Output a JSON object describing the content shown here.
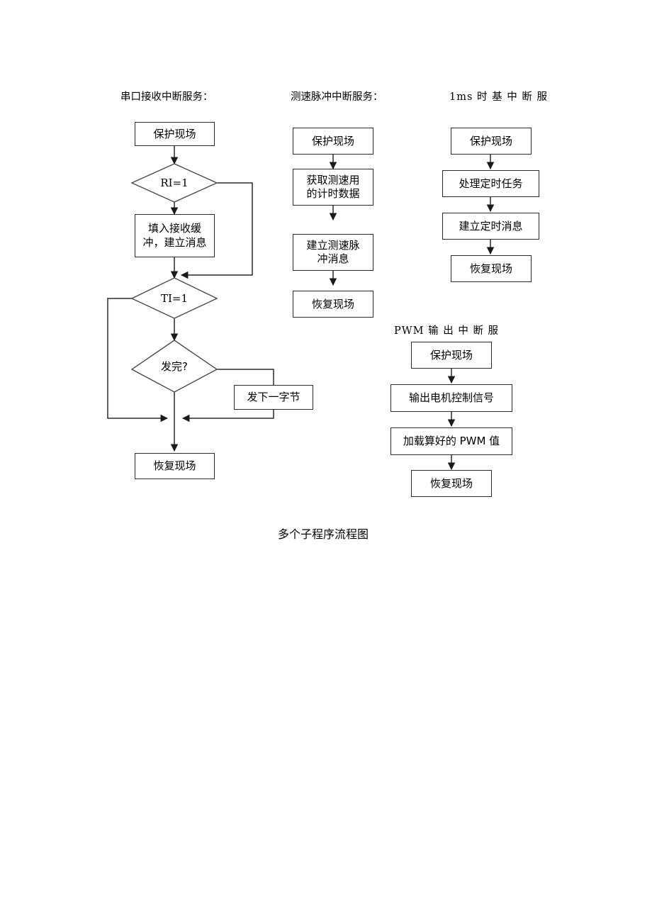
{
  "page": {
    "caption": "多个子程序流程图",
    "background": "#ffffff",
    "line_color": "#2b2b2b",
    "text_color": "#000000"
  },
  "columns": {
    "serial_rx": {
      "header": "串口接收中断服务：",
      "nodes": {
        "save_context": "保护现场",
        "ri_check": "RI=1",
        "fill_buffer": "填入接收缓\n冲，建立消息",
        "ti_check": "TI=1",
        "send_done": "发完?",
        "send_next_byte": "发下一字节",
        "restore_context": "恢复现场"
      }
    },
    "speed_pulse": {
      "header": "测速脉冲中断服务：",
      "nodes": {
        "save_context": "保护现场",
        "get_timing_data": "获取测速用\n的计时数据",
        "build_message": "建立测速脉\n冲消息",
        "restore_context": "恢复现场"
      }
    },
    "timebase_1ms": {
      "header": "1ms 时 基 中 断 服",
      "nodes": {
        "save_context": "保护现场",
        "handle_timed_task": "处理定时任务",
        "build_timer_message": "建立定时消息",
        "restore_context": "恢复现场"
      }
    },
    "pwm_output": {
      "header": "PWM 输 出 中 断 服",
      "nodes": {
        "save_context": "保护现场",
        "output_motor_signal": "输出电机控制信号",
        "load_pwm_value": "加载算好的 PWM 值",
        "restore_context": "恢复现场"
      }
    }
  }
}
